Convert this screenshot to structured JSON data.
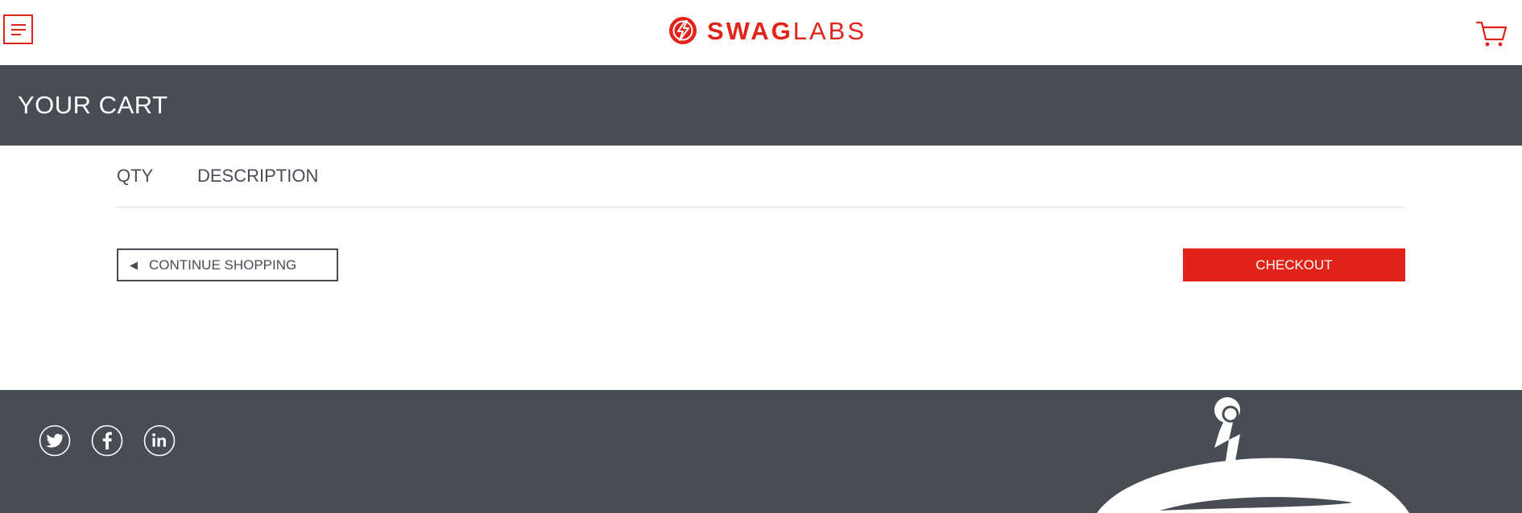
{
  "header": {
    "menu_icon": "hamburger-menu-icon",
    "logo": {
      "bold": "SWAG",
      "light": "LABS",
      "mark_icon": "lightning-bolt-logo-icon"
    },
    "cart_icon": "shopping-cart-icon"
  },
  "title_bar": {
    "title": "YOUR CART"
  },
  "cart_list": {
    "columns": {
      "qty": "QTY",
      "description": "DESCRIPTION"
    }
  },
  "actions": {
    "continue_arrow": "◀",
    "continue_label": "CONTINUE SHOPPING",
    "checkout_label": "CHECKOUT"
  },
  "footer": {
    "social": [
      {
        "name": "Twitter",
        "icon": "twitter-icon"
      },
      {
        "name": "Facebook",
        "icon": "facebook-icon"
      },
      {
        "name": "LinkedIn",
        "icon": "linkedin-icon"
      }
    ],
    "mascot": "swag-bot-mascot"
  },
  "colors": {
    "brand_red": "#e2231a",
    "bar_gray": "#474c55",
    "divider": "#dddddd"
  }
}
